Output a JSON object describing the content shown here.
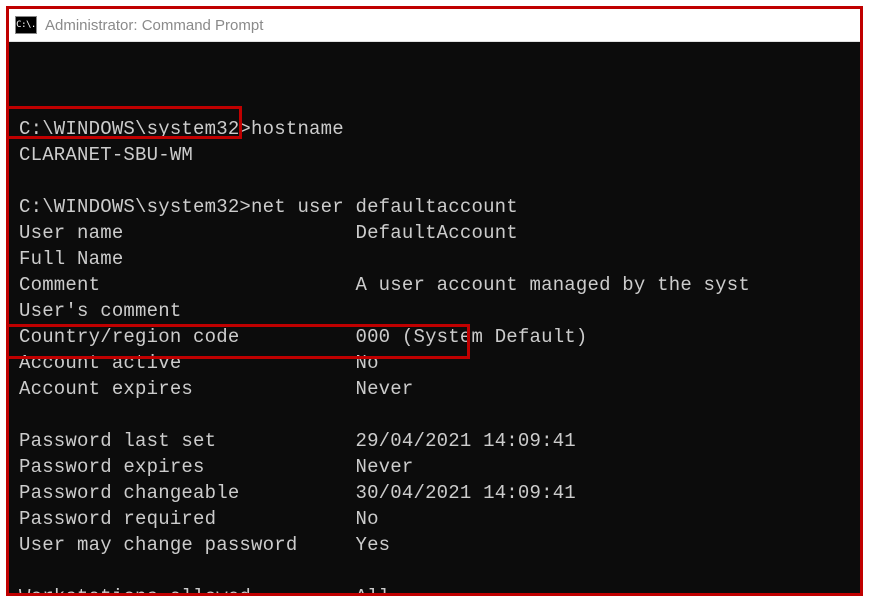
{
  "window": {
    "icon_label": "C:\\.",
    "title": "Administrator: Command Prompt"
  },
  "terminal": {
    "prompt1_path": "C:\\WINDOWS\\system32>",
    "cmd1": "hostname",
    "hostname_output": "CLARANET-SBU-WM",
    "prompt2_path": "C:\\WINDOWS\\system32>",
    "cmd2": "net user defaultaccount",
    "fields": {
      "user_name_label": "User name",
      "user_name_value": "DefaultAccount",
      "full_name_label": "Full Name",
      "full_name_value": "",
      "comment_label": "Comment",
      "comment_value": "A user account managed by the syst",
      "users_comment_label": "User's comment",
      "users_comment_value": "",
      "country_label": "Country/region code",
      "country_value": "000 (System Default)",
      "account_active_label": "Account active",
      "account_active_value": "No",
      "account_expires_label": "Account expires",
      "account_expires_value": "Never",
      "pwd_last_set_label": "Password last set",
      "pwd_last_set_value": "29/04/2021 14:09:41",
      "pwd_expires_label": "Password expires",
      "pwd_expires_value": "Never",
      "pwd_changeable_label": "Password changeable",
      "pwd_changeable_value": "30/04/2021 14:09:41",
      "pwd_required_label": "Password required",
      "pwd_required_value": "No",
      "user_may_change_label": "User may change password",
      "user_may_change_value": "Yes",
      "workstations_label": "Workstations allowed",
      "workstations_value": "All"
    }
  }
}
